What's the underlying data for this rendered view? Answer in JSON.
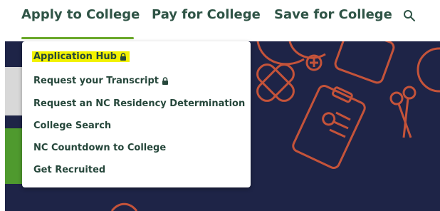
{
  "nav": {
    "items": [
      {
        "label": "Apply to College"
      },
      {
        "label": "Pay for College"
      },
      {
        "label": "Save for College"
      }
    ],
    "search_icon": "search-icon",
    "active_underline_color": "#6aa829",
    "text_color": "#2f5446"
  },
  "dropdown": {
    "items": [
      {
        "label": "Application Hub",
        "locked": true,
        "highlighted": true
      },
      {
        "label": "Request your Transcript",
        "locked": true,
        "highlighted": false
      },
      {
        "label": "Request an NC Residency Determination",
        "locked": false,
        "highlighted": false
      },
      {
        "label": "College Search",
        "locked": false,
        "highlighted": false
      },
      {
        "label": "NC Countdown to College",
        "locked": false,
        "highlighted": false
      },
      {
        "label": "Get Recruited",
        "locked": false,
        "highlighted": false
      }
    ],
    "highlight_color": "#f2f200",
    "lock_icon": "lock-icon"
  },
  "hero": {
    "background_color": "#1e2447",
    "art_color": "#c4533a"
  }
}
